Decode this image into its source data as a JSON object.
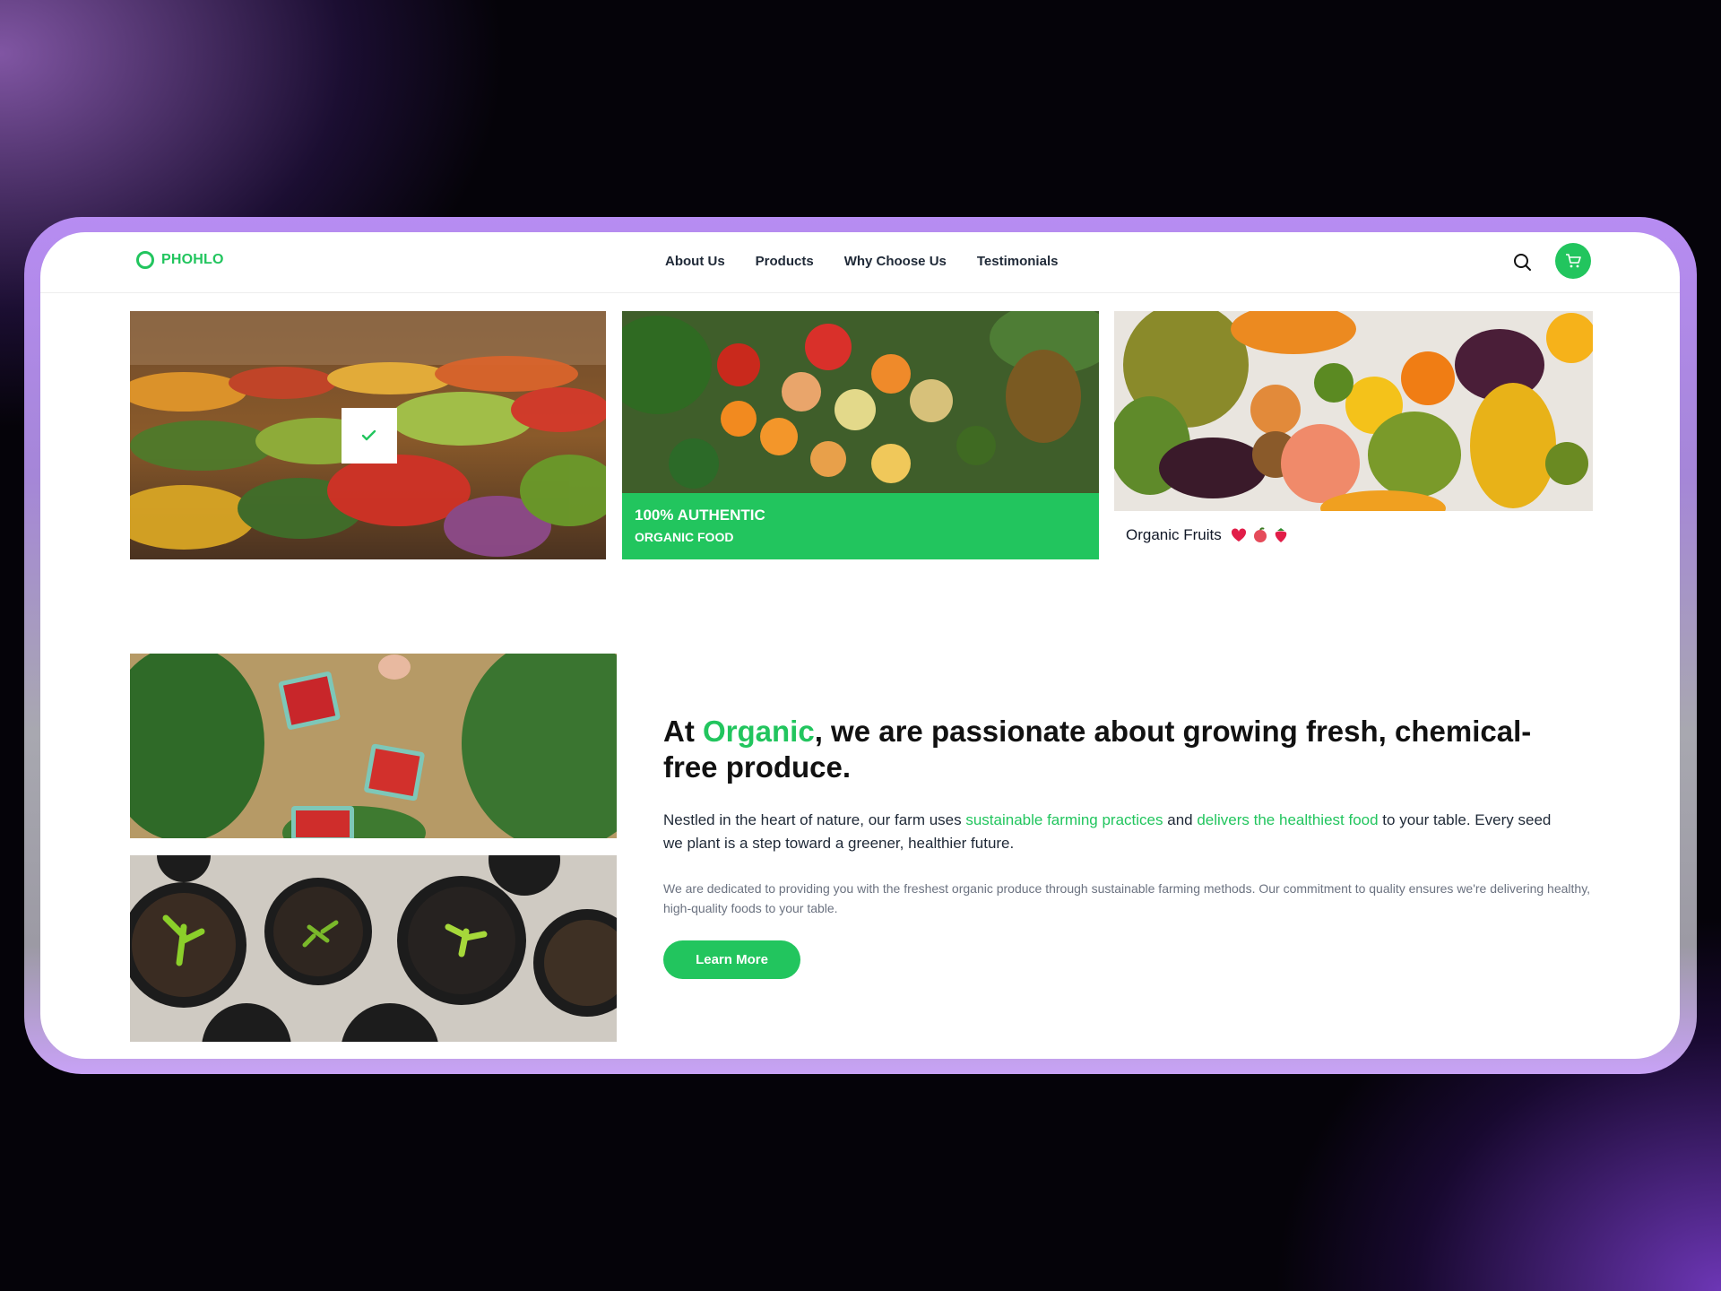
{
  "brand": {
    "name": "PHOHLO",
    "color": "#22c55e"
  },
  "nav": {
    "items": [
      {
        "label": "About Us"
      },
      {
        "label": "Products"
      },
      {
        "label": "Why Choose Us"
      },
      {
        "label": "Testimonials"
      }
    ]
  },
  "header_icons": {
    "search": "search-icon",
    "cart": "cart-icon"
  },
  "gallery": {
    "market": {
      "icon": "check-icon"
    },
    "authentic": {
      "line1": "100% AUTHENTIC",
      "line2": "ORGANIC FOOD"
    },
    "fruits": {
      "label": "Organic Fruits",
      "emojis": [
        "heart-icon",
        "apple-icon",
        "strawberry-icon"
      ]
    }
  },
  "about": {
    "headline_pre": "At ",
    "headline_accent": "Organic",
    "headline_post": ", we are passionate about growing fresh, chemical-free produce.",
    "lead_1": "Nestled in the heart of nature, our farm uses ",
    "lead_hl_1": "sustainable farming practices",
    "lead_2": " and ",
    "lead_hl_2": "delivers the healthiest food",
    "lead_3": " to your table. Every seed we plant is a step toward a greener, healthier future.",
    "fine": "We are dedicated to providing you with the freshest organic produce through sustainable farming methods. Our commitment to quality ensures we're delivering healthy, high-quality foods to your table.",
    "cta": "Learn More"
  }
}
